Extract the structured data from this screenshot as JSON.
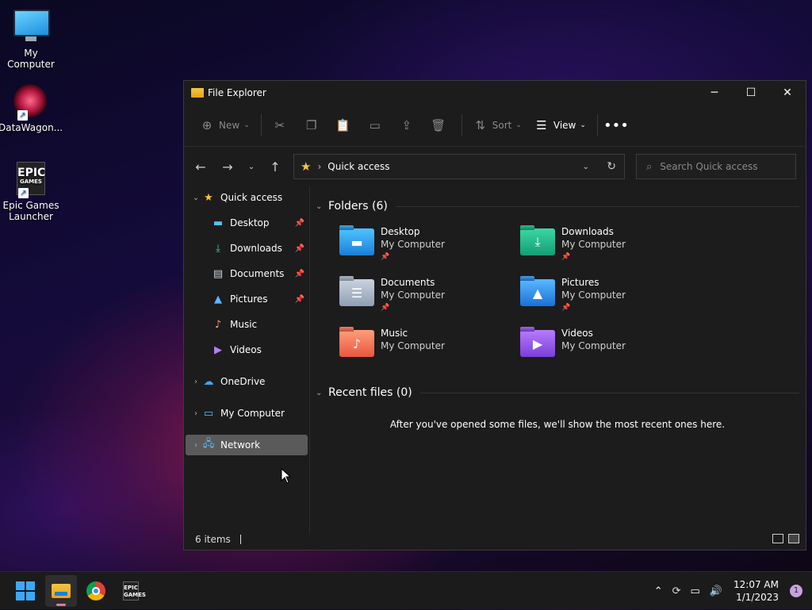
{
  "desktop": {
    "icons": [
      {
        "label": "My Computer"
      },
      {
        "label": "DataWagon..."
      },
      {
        "label": "Epic Games Launcher",
        "glyph": "EPIC",
        "glyph_sub": "GAMES"
      }
    ]
  },
  "window": {
    "title": "File Explorer",
    "controls": {
      "minimize": "─",
      "maximize": "☐",
      "close": "✕"
    }
  },
  "toolbar": {
    "new_label": "New",
    "sort_label": "Sort",
    "view_label": "View"
  },
  "navigation": {
    "address_location": "Quick access",
    "search_placeholder": "Search Quick access"
  },
  "sidebar": {
    "quick_access": "Quick access",
    "pinned_items": [
      {
        "label": "Desktop",
        "pinned": true
      },
      {
        "label": "Downloads",
        "pinned": true
      },
      {
        "label": "Documents",
        "pinned": true
      },
      {
        "label": "Pictures",
        "pinned": true
      },
      {
        "label": "Music",
        "pinned": false
      },
      {
        "label": "Videos",
        "pinned": false
      }
    ],
    "onedrive": "OneDrive",
    "my_computer": "My Computer",
    "network": "Network"
  },
  "content": {
    "folders_header": "Folders (6)",
    "folders": [
      {
        "name": "Desktop",
        "location": "My Computer",
        "pinned": true
      },
      {
        "name": "Downloads",
        "location": "My Computer",
        "pinned": true
      },
      {
        "name": "Documents",
        "location": "My Computer",
        "pinned": true
      },
      {
        "name": "Pictures",
        "location": "My Computer",
        "pinned": true
      },
      {
        "name": "Music",
        "location": "My Computer",
        "pinned": false
      },
      {
        "name": "Videos",
        "location": "My Computer",
        "pinned": false
      }
    ],
    "recent_header": "Recent files (0)",
    "recent_empty_message": "After you've opened some files, we'll show the most recent ones here."
  },
  "status": {
    "item_count": "6 items"
  },
  "taskbar": {
    "epic_glyph": "EPIC",
    "epic_glyph_sub": "GAMES",
    "time": "12:07 AM",
    "date": "1/1/2023",
    "notification_count": "1"
  }
}
